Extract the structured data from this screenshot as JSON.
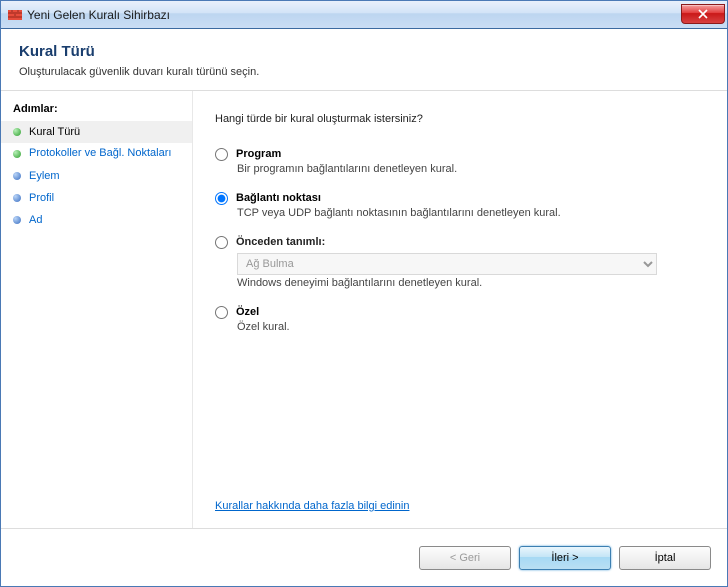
{
  "window": {
    "title": "Yeni Gelen Kuralı Sihirbazı"
  },
  "header": {
    "title": "Kural Türü",
    "description": "Oluşturulacak güvenlik duvarı kuralı türünü seçin."
  },
  "sidebar": {
    "heading": "Adımlar:",
    "steps": [
      {
        "label": "Kural Türü"
      },
      {
        "label": "Protokoller ve Bağl. Noktaları"
      },
      {
        "label": "Eylem"
      },
      {
        "label": "Profil"
      },
      {
        "label": "Ad"
      }
    ]
  },
  "content": {
    "prompt": "Hangi türde bir kural oluşturmak istersiniz?",
    "options": {
      "program": {
        "title": "Program",
        "desc": "Bir programın bağlantılarını denetleyen kural."
      },
      "port": {
        "title": "Bağlantı noktası",
        "desc": "TCP veya UDP bağlantı noktasının bağlantılarını denetleyen kural."
      },
      "predefined": {
        "title": "Önceden tanımlı:",
        "select_value": "Ağ Bulma",
        "desc": "Windows deneyimi bağlantılarını denetleyen kural."
      },
      "custom": {
        "title": "Özel",
        "desc": "Özel kural."
      }
    },
    "learn_more": "Kurallar hakkında daha fazla bilgi edinin"
  },
  "footer": {
    "back": "< Geri",
    "next": "İleri >",
    "cancel": "İptal"
  }
}
